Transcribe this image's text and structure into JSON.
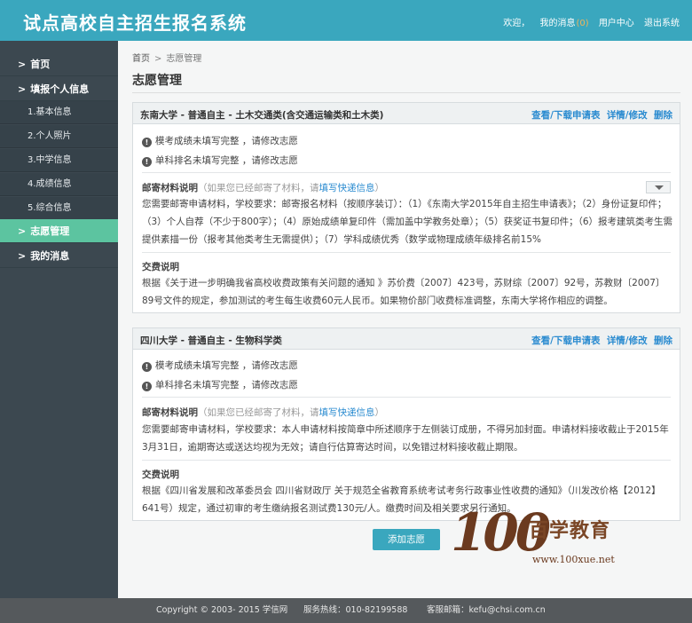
{
  "header": {
    "title": "试点高校自主招生报名系统",
    "welcome": "欢迎，",
    "my_messages": "我的消息",
    "message_count": "(0)",
    "user_center": "用户中心",
    "logout": "退出系统"
  },
  "sidebar": {
    "items": [
      {
        "label": "首页"
      },
      {
        "label": "填报个人信息"
      },
      {
        "label": "1.基本信息"
      },
      {
        "label": "2.个人照片"
      },
      {
        "label": "3.中学信息"
      },
      {
        "label": "4.成绩信息"
      },
      {
        "label": "5.综合信息"
      },
      {
        "label": "志愿管理"
      },
      {
        "label": "我的消息"
      }
    ]
  },
  "breadcrumb": {
    "home": "首页",
    "current": "志愿管理"
  },
  "page_title": "志愿管理",
  "cards": [
    {
      "title": "东南大学 - 普通自主 - 土木交通类(含交通运输类和土木类)",
      "actions": {
        "view": "查看/下载申请表",
        "edit": "详情/修改",
        "delete": "删除"
      },
      "warn1": "模考成绩未填写完整 ，请修改志愿",
      "warn2": "单科排名未填写完整 ，请修改志愿",
      "mail_label": "邮寄材料说明",
      "mail_note": "（如果您已经邮寄了材料，请",
      "mail_link": "填写快递信息",
      "mail_note_end": "）",
      "mail_text": "您需要邮寄申请材料，学校要求：邮寄报名材料（按顺序装订）：（1）《东南大学2015年自主招生申请表》；（2）身份证复印件；（3）个人自荐（不少于800字）；（4）原始成绩单复印件（需加盖中学教务处章）；（5）获奖证书复印件；（6）报考建筑类考生需提供素描一份（报考其他类考生无需提供）；（7）学科成绩优秀（数学或物理成绩年级排名前15%",
      "fee_label": "交费说明",
      "fee_text": "根据《关于进一步明确我省高校收费政策有关问题的通知 》苏价费〔2007〕423号，苏财综〔2007〕92号，苏教财〔2007〕89号文件的规定，参加测试的考生每生收费60元人民币。如果物价部门收费标准调整，东南大学将作相应的调整。"
    },
    {
      "title": "四川大学 - 普通自主 - 生物科学类",
      "actions": {
        "view": "查看/下载申请表",
        "edit": "详情/修改",
        "delete": "删除"
      },
      "warn1": "模考成绩未填写完整 ，请修改志愿",
      "warn2": "单科排名未填写完整 ，请修改志愿",
      "mail_label": "邮寄材料说明",
      "mail_note": "（如果您已经邮寄了材料，请",
      "mail_link": "填写快递信息",
      "mail_note_end": "）",
      "mail_text": "您需要邮寄申请材料，学校要求：本人申请材料按简章中所述顺序于左侧装订成册，不得另加封面。申请材料接收截止于2015年3月31日，逾期寄达或送达均视为无效；请自行估算寄达时间，以免错过材料接收截止期限。",
      "fee_label": "交费说明",
      "fee_text": "根据《四川省发展和改革委员会 四川省财政厅 关于规范全省教育系统考试考务行政事业性收费的通知》（川发改价格【2012】641号）规定，通过初审的考生缴纳报名测试费130元/人。缴费时间及相关要求另行通知。"
    }
  ],
  "add_button": "添加志愿",
  "watermark": {
    "number": "100",
    "name": "百学教育",
    "url": "www.100xue.net"
  },
  "footer": {
    "copyright": "Copyright © 2003- 2015 学信网",
    "hotline": "服务热线：010-82199588",
    "email": "客服邮箱：kefu@chsi.com.cn"
  }
}
